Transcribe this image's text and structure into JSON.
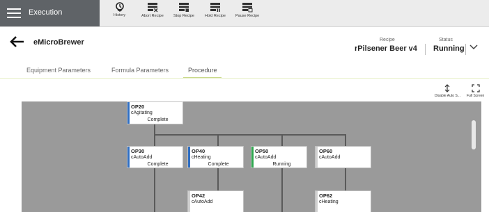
{
  "app": {
    "title": "Execution"
  },
  "toolbar": {
    "items": [
      {
        "label": "History",
        "icon": "history-icon"
      },
      {
        "label": "Abort Recipe",
        "icon": "abort-recipe-icon"
      },
      {
        "label": "Stop Recipe",
        "icon": "stop-recipe-icon"
      },
      {
        "label": "Hold Recipe",
        "icon": "hold-recipe-icon"
      },
      {
        "label": "Pause Recipe",
        "icon": "pause-recipe-icon"
      }
    ]
  },
  "header": {
    "unit_name": "eMicroBrewer",
    "recipe_label": "Recipe",
    "recipe_value": "rPilsener Beer  v4",
    "status_label": "Status",
    "status_value": "Running"
  },
  "tabs": [
    "Equipment Parameters",
    "Formula Parameters",
    "Procedure"
  ],
  "active_tab": "Procedure",
  "controls": {
    "disable_auto": "Disable Auto S...",
    "full_screen": "Full Screen"
  },
  "colors": {
    "complete": "#2f6fc4",
    "running": "#2fa84f",
    "idle": "#d0d0d0"
  },
  "operations": [
    {
      "id": "OP20",
      "class": "cAgitating",
      "status": "Complete"
    },
    {
      "id": "OP30",
      "class": "cAutoAdd",
      "status": "Complete"
    },
    {
      "id": "OP40",
      "class": "cHeating",
      "status": "Complete"
    },
    {
      "id": "OP50",
      "class": "cAutoAdd",
      "status": "Running"
    },
    {
      "id": "OP60",
      "class": "cAutoAdd",
      "status": ""
    },
    {
      "id": "OP42",
      "class": "cAutoAdd",
      "status": ""
    },
    {
      "id": "OP62",
      "class": "cHeating",
      "status": ""
    }
  ]
}
